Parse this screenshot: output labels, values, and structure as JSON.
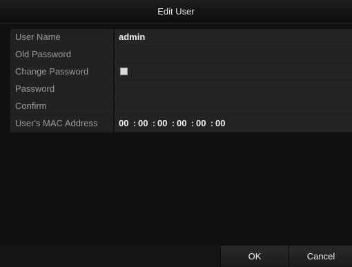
{
  "dialog": {
    "title": "Edit User"
  },
  "form": {
    "rows": [
      {
        "label": "User Name",
        "value": "admin"
      },
      {
        "label": "Old Password",
        "value": ""
      },
      {
        "label": "Change Password",
        "checked": false
      },
      {
        "label": "Password",
        "value": ""
      },
      {
        "label": "Confirm",
        "value": ""
      },
      {
        "label": "User's MAC Address",
        "mac": [
          "00",
          "00",
          "00",
          "00",
          "00",
          "00"
        ]
      }
    ],
    "mac_separator": ":"
  },
  "footer": {
    "ok_label": "OK",
    "cancel_label": "Cancel"
  },
  "colors": {
    "background": "#101010",
    "label_bg": "#222222",
    "value_bg": "#242424",
    "label_text": "#9a9a9a",
    "value_text": "#f0f0f0"
  }
}
